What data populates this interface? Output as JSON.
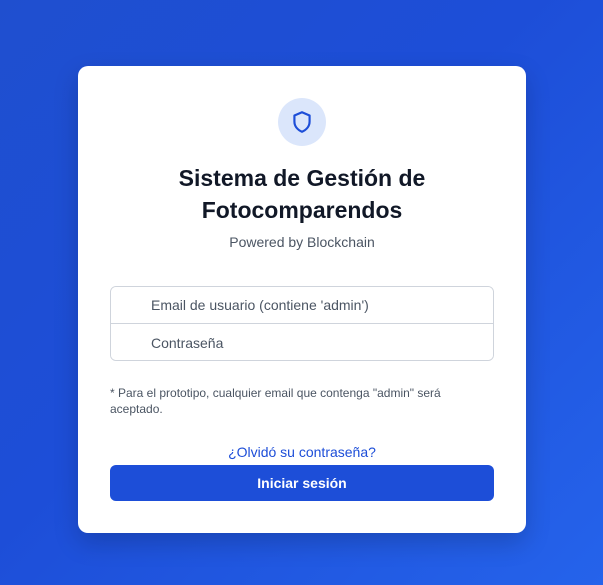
{
  "login": {
    "title": "Sistema de Gestión de Fotocomparendos",
    "subtitle": "Powered by Blockchain",
    "email_placeholder": "Email de usuario (contiene 'admin')",
    "password_placeholder": "Contraseña",
    "note": "* Para el prototipo, cualquier email que contenga \"admin\" será aceptado.",
    "forgot_label": "¿Olvidó su contraseña?",
    "submit_label": "Iniciar sesión"
  },
  "icons": {
    "header_icon": "shield-icon"
  },
  "colors": {
    "background": "#1d4ed8",
    "accent": "#1d4ed8",
    "icon_bg": "#dbe6fb",
    "card": "#ffffff"
  }
}
